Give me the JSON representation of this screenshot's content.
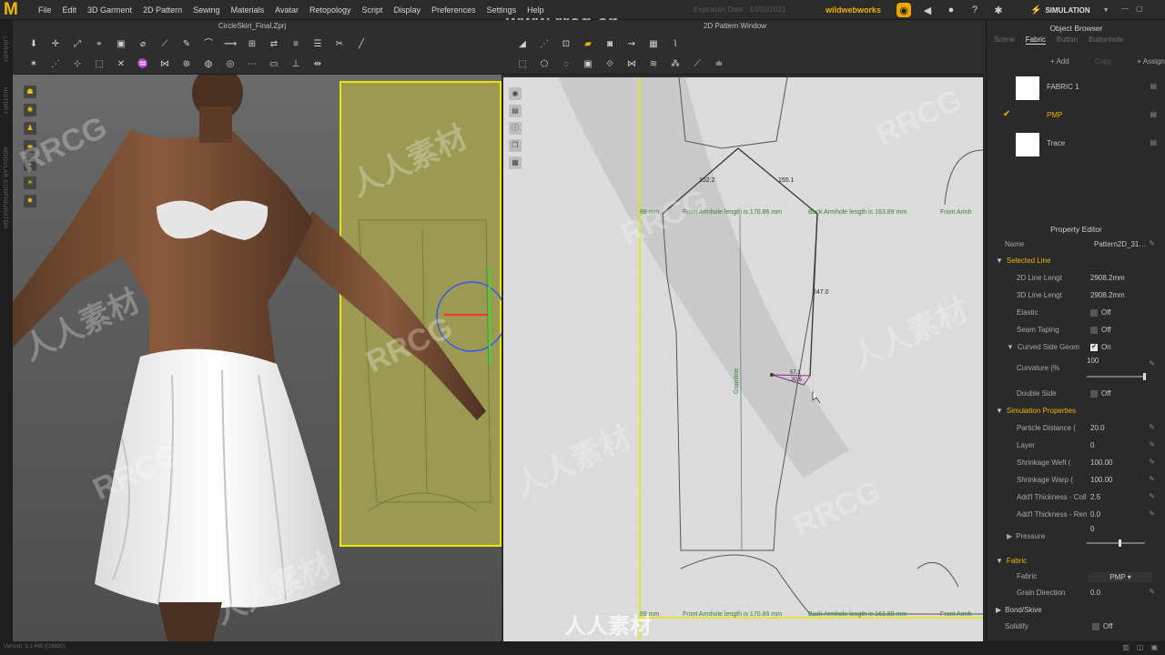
{
  "app": {
    "logo": "M",
    "menus": [
      "File",
      "Edit",
      "3D Garment",
      "2D Pattern",
      "Sewing",
      "Materials",
      "Avatar",
      "Retopology",
      "Script",
      "Display",
      "Preferences",
      "Settings",
      "Help"
    ],
    "site_watermark": "www.rrcg.cn",
    "expiration": "Expiration Date : 10/03/2021",
    "username": "wildwebworks",
    "mode": "SIMULATION",
    "left_tabs": [
      "LIBRARY",
      "HISTORY",
      "MODULAR CONFIGURATOR"
    ]
  },
  "window3d": {
    "title": "CircleSkirt_Final.Zprj"
  },
  "window2d": {
    "title": "2D Pattern Window",
    "labels": {
      "front_armhole_top": "Front Armhole length is 170.86 mm",
      "back_armhole_top": "Back Armhole length is 163.89 mm",
      "front_armhole_right": "Front Armh",
      "left_partial": "89 mm",
      "front_armhole_bottom": "Front Armhole length is 170.86 mm",
      "back_armhole_bottom": "Back Armhole length is 163.89 mm",
      "front_armhole_bottom_right": "Front Armh",
      "grainline": "Grainline",
      "m1": "152.2",
      "m2": "155.1",
      "m3": "247.0",
      "m4": "57.1",
      "m5": "20.5"
    }
  },
  "object_browser": {
    "title": "Object Browser",
    "tabs": [
      "Scene",
      "Fabric",
      "Button",
      "Buttonhole"
    ],
    "active_tab": "Fabric",
    "buttons": [
      "+ Add",
      "Copy",
      "+ Assign"
    ],
    "items": [
      "FABRIC 1",
      "PMP",
      "Trace"
    ]
  },
  "property_editor": {
    "title": "Property Editor",
    "name_label": "Name",
    "name_value": "Pattern2D_31…",
    "sections": {
      "selected_line": "Selected Line",
      "simulation": "Simulation Properties",
      "fabric": "Fabric",
      "bond": "Bond/Skive"
    },
    "rows": {
      "line2d_label": "2D Line Lengt",
      "line2d_value": "2908.2mm",
      "line3d_label": "3D Line Lengt",
      "line3d_value": "2908.2mm",
      "elastic_label": "Elastic",
      "elastic_value": "Off",
      "seam_label": "Seam Taping",
      "seam_value": "Off",
      "curved_label": "Curved Side Geom",
      "curved_value": "On",
      "curvature_label": "Curvature (%",
      "curvature_value": "100",
      "double_label": "Double Side",
      "double_value": "Off",
      "particle_label": "Particle Distance (",
      "particle_value": "20.0",
      "layer_label": "Layer",
      "layer_value": "0",
      "weft_label": "Shrinkage Weft (",
      "weft_value": "100.00",
      "warp_label": "Shrinkage Warp (",
      "warp_value": "100.00",
      "thickcol_label": "Add'l Thickness - Coll",
      "thickcol_value": "2.5",
      "thickren_label": "Add'l Thickness - Ren",
      "thickren_value": "0.0",
      "pressure_label": "Pressure",
      "pressure_value": "0",
      "fabric_label": "Fabric",
      "fabric_value": "PMP",
      "grain_label": "Grain Direction",
      "grain_value": "0.0",
      "solidify_label": "Solidify",
      "solidify_value": "Off"
    }
  },
  "status": {
    "version": "Version: 5.1.445 (r28680)"
  },
  "watermarks": [
    "RRCG",
    "人人素材"
  ],
  "colors": {
    "accent": "#f0b400",
    "pattern_highlight": "#e8e800",
    "measure_text": "#3a7a3a"
  }
}
